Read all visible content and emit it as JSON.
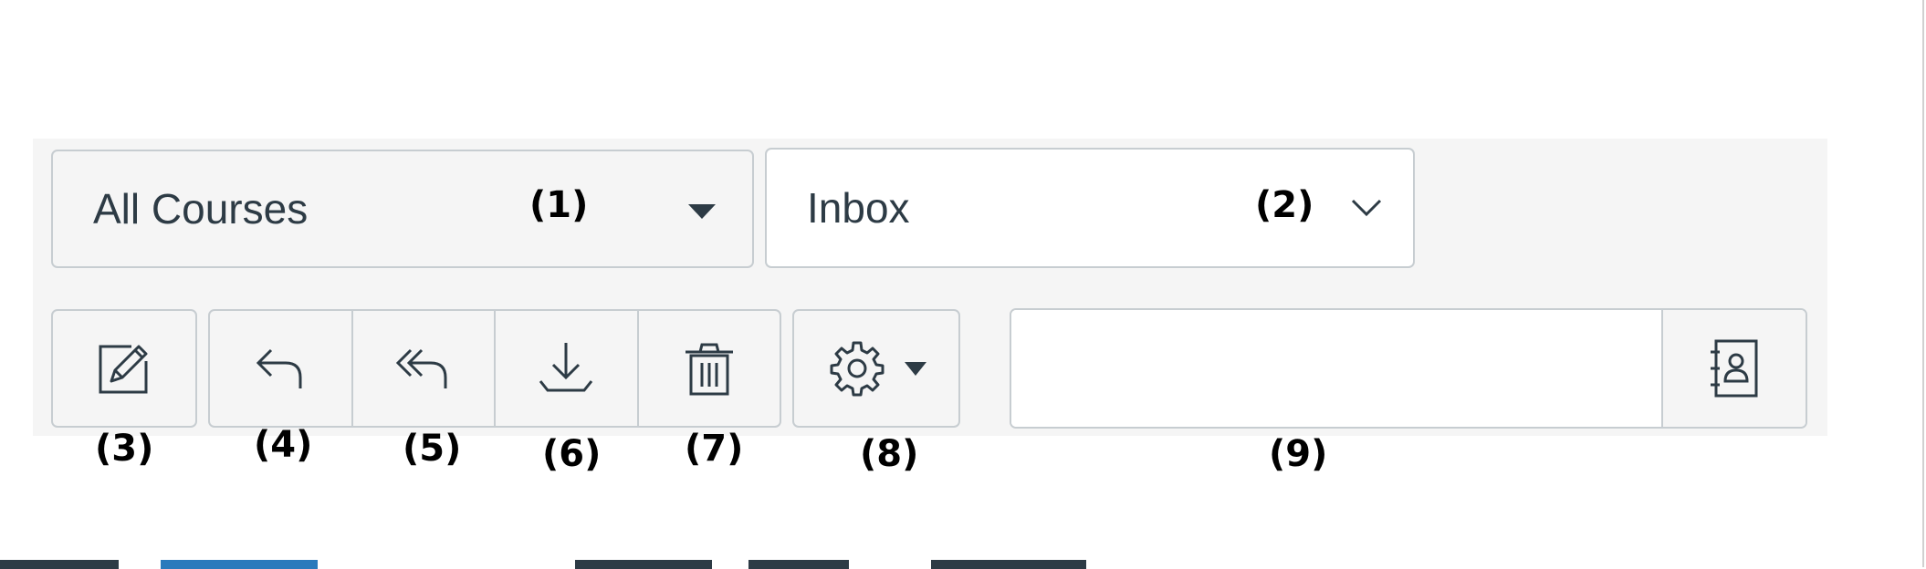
{
  "filters": {
    "course_select": {
      "value": "All Courses",
      "marker": "(1)"
    },
    "mailbox_select": {
      "value": "Inbox",
      "marker": "(2)"
    }
  },
  "toolbar": {
    "compose": {
      "icon": "compose-icon",
      "marker": "(3)"
    },
    "reply": {
      "icon": "reply-icon",
      "marker": "(4)"
    },
    "reply_all": {
      "icon": "reply-all-icon",
      "marker": "(5)"
    },
    "archive": {
      "icon": "archive-icon",
      "marker": "(6)"
    },
    "delete": {
      "icon": "trash-icon",
      "marker": "(7)"
    },
    "settings": {
      "icon": "gear-icon",
      "marker": "(8)"
    },
    "search": {
      "value": "",
      "placeholder": "",
      "marker": "(9)",
      "addressbook_icon": "address-book-icon"
    }
  },
  "colors": {
    "toolbar_bg": "#f5f5f5",
    "border": "#c7cdd1",
    "text": "#2d3b45"
  }
}
